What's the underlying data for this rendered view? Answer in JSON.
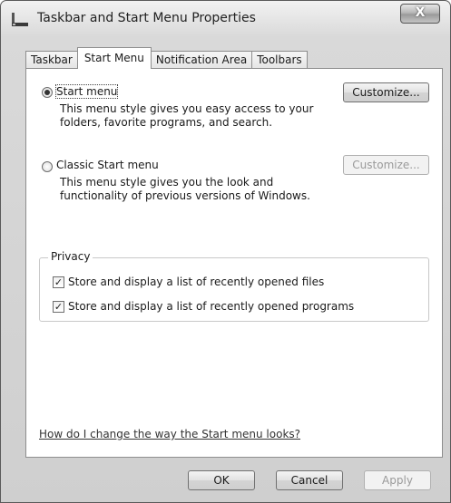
{
  "window": {
    "title": "Taskbar and Start Menu Properties",
    "close_label": "X"
  },
  "tabs": [
    {
      "label": "Taskbar",
      "selected": false
    },
    {
      "label": "Start Menu",
      "selected": true
    },
    {
      "label": "Notification Area",
      "selected": false
    },
    {
      "label": "Toolbars",
      "selected": false
    }
  ],
  "start_menu_option": {
    "label": "Start menu",
    "selected": true,
    "description": "This menu style gives you easy access to your folders, favorite programs, and search.",
    "customize_label": "Customize..."
  },
  "classic_option": {
    "label": "Classic Start menu",
    "selected": false,
    "description": "This menu style gives you the look and functionality of previous versions of Windows.",
    "customize_label": "Customize..."
  },
  "privacy": {
    "legend": "Privacy",
    "items": [
      {
        "label": "Store and display a list of recently opened files",
        "checked": true
      },
      {
        "label": "Store and display a list of recently opened programs",
        "checked": true
      }
    ]
  },
  "help_link": "How do I change the way the Start menu looks?",
  "footer": {
    "ok_label": "OK",
    "cancel_label": "Cancel",
    "apply_label": "Apply"
  },
  "icons": {
    "app": "taskbar-icon",
    "close": "close-icon",
    "check": "✓"
  }
}
